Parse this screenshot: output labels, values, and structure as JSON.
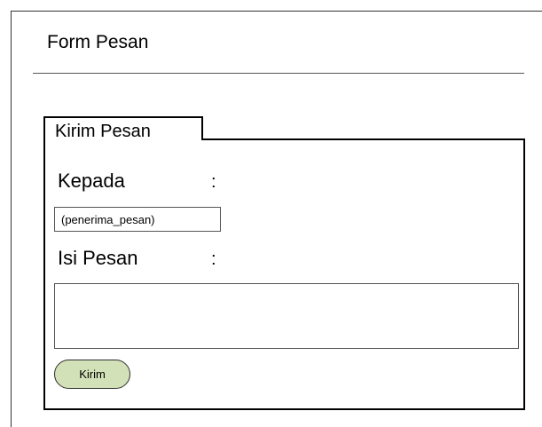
{
  "page": {
    "title": "Form Pesan"
  },
  "form": {
    "tab_label": "Kirim Pesan",
    "recipient": {
      "label": "Kepada",
      "colon": ":",
      "value": "(penerima_pesan)"
    },
    "message": {
      "label": "Isi Pesan",
      "colon": ":",
      "value": ""
    },
    "submit_label": "Kirim"
  },
  "colors": {
    "button_fill": "#d3e1b8",
    "border": "#000000"
  }
}
